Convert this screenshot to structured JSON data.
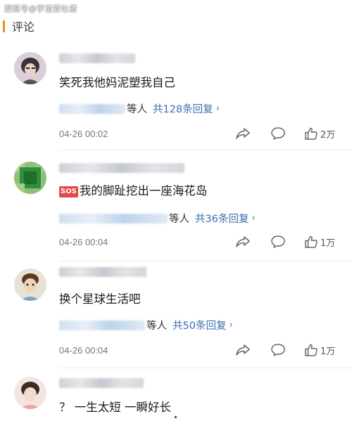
{
  "watermark": "搜狐号@学渣爱吐槽",
  "section": {
    "title": "评论"
  },
  "colors": {
    "accent": "#f08a1c",
    "link": "#3a6fb0",
    "sos_badge": "#e34848"
  },
  "comments": [
    {
      "text": "笑死我他妈泥塑我自己",
      "reply_suffix": "等人",
      "reply_link": "共128条回复",
      "time": "04-26 00:02",
      "likes": "2万"
    },
    {
      "badge": "SOS",
      "text": "我的脚趾挖出一座海花岛",
      "reply_suffix": "等人",
      "reply_link": "共36条回复",
      "time": "04-26 00:04",
      "likes": "1万"
    },
    {
      "text": "换个星球生活吧",
      "reply_suffix": "等人",
      "reply_link": "共50条回复",
      "time": "04-26 00:04",
      "likes": "1万"
    },
    {
      "text": "？ 一生太短 一瞬好长"
    }
  ],
  "icons": {
    "share": "share-icon",
    "comment": "comment-bubble-icon",
    "like": "thumbs-up-icon",
    "reply_more": "chevron-right-icon"
  }
}
